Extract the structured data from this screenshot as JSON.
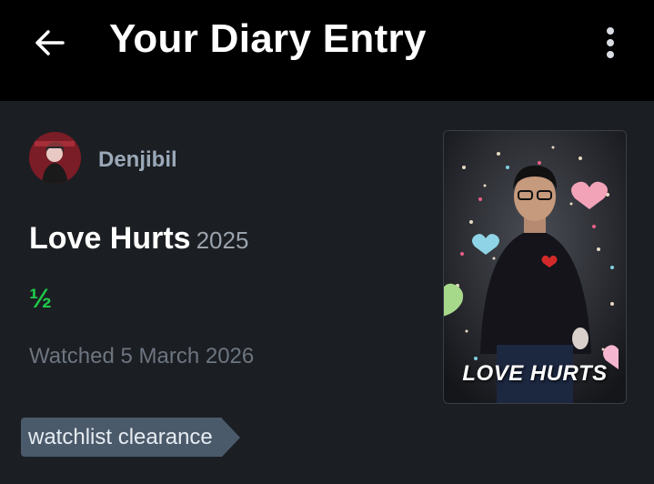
{
  "header": {
    "title": "Your Diary Entry",
    "back_icon": "arrow-left-icon",
    "menu_icon": "more-vertical-icon"
  },
  "entry": {
    "username": "Denjibil",
    "film_title": "Love Hurts",
    "film_year": "2025",
    "rating": "½",
    "watched_text": "Watched 5 March 2026",
    "tags": [
      "watchlist clearance"
    ]
  },
  "poster": {
    "title": "LOVE HURTS"
  },
  "colors": {
    "background": "#1b1e22",
    "header_bg": "#000000",
    "rating_green": "#1fc74a",
    "tag_bg": "#4b5a6a",
    "username": "#9aa8b8"
  }
}
